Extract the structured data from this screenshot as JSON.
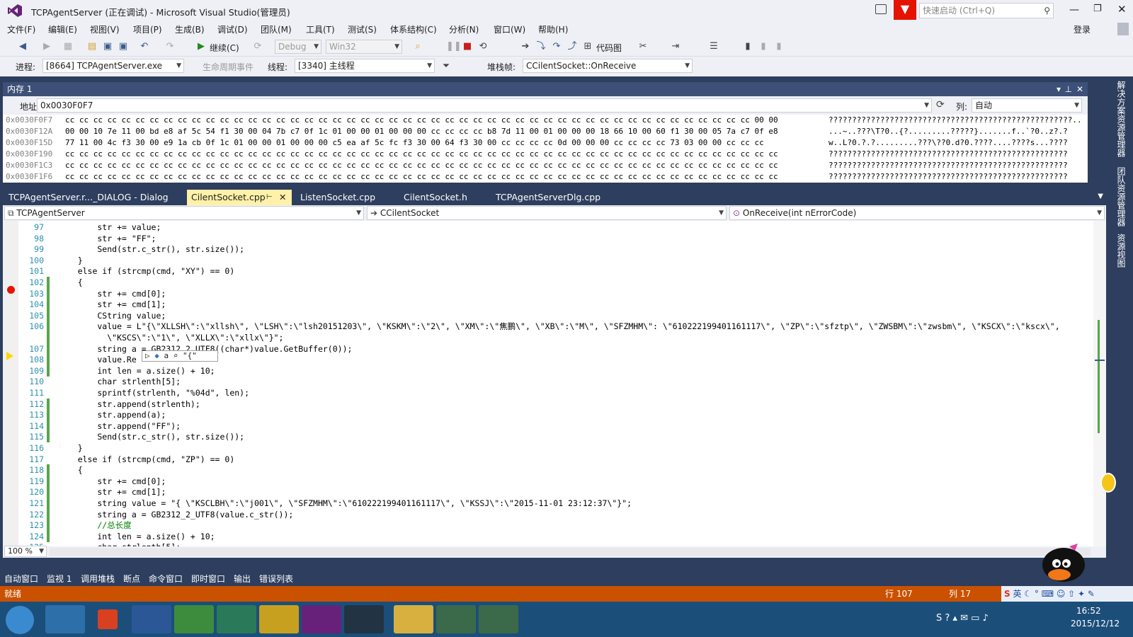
{
  "window": {
    "title": "TCPAgentServer (正在调试) - Microsoft Visual Studio(管理员)",
    "quick_launch": "快速启动 (Ctrl+Q)",
    "login": "登录"
  },
  "menu": [
    "文件(F)",
    "编辑(E)",
    "视图(V)",
    "项目(P)",
    "生成(B)",
    "调试(D)",
    "团队(M)",
    "工具(T)",
    "测试(S)",
    "体系结构(C)",
    "分析(N)",
    "窗口(W)",
    "帮助(H)"
  ],
  "toolbar1": {
    "continue": "继续(C)",
    "config": "Debug",
    "platform": "Win32",
    "codemap": "代码图"
  },
  "toolbar2": {
    "process_label": "进程:",
    "process": "[8664] TCPAgentServer.exe",
    "lifecycle": "生命周期事件",
    "thread_label": "线程:",
    "thread": "[3340] 主线程",
    "stack_label": "堆栈帧:",
    "stack": "CCilentSocket::OnReceive"
  },
  "memory": {
    "title": "内存 1",
    "addr_label": "地址:",
    "addr": "0x0030F0F7",
    "col_label": "列:",
    "col": "自动",
    "rows": [
      {
        "addr": "0x0030F0F7",
        "hex": "cc cc cc cc cc cc cc cc cc cc cc cc cc cc cc cc cc cc cc cc cc cc cc cc cc cc cc cc cc cc cc cc cc cc cc cc cc cc cc cc cc cc cc cc cc cc cc cc cc 00 00",
        "ascii": "????????????????????????????????????????????????????.."
      },
      {
        "addr": "0x0030F12A",
        "hex": "00 00 10 7e 11 00 bd e8 af 5c 54 f1 30 00 04 7b c7 0f 1c 01 00 00 01 00 00 00 cc cc cc cc b8 7d 11 00 01 00 00 00 18 66 10 00 60 f1 30 00 05 7a c7 0f e8",
        "ascii": "...~..???\\T?0..{?.........?????}.......f..`?0..z?.?"
      },
      {
        "addr": "0x0030F15D",
        "hex": "77 11 00 4c f3 30 00 e9 1a cb 0f 1c 01 00 00 01 00 00 00 c5 ea af 5c fc f3 30 00 64 f3 30 00 cc cc cc cc 0d 00 00 00 cc cc cc cc 73 03 00 00 cc cc cc",
        "ascii": "w..L?0.?.?.........???\\??0.d?0.????....????s...????"
      },
      {
        "addr": "0x0030F190",
        "hex": "cc cc cc cc cc cc cc cc cc cc cc cc cc cc cc cc cc cc cc cc cc cc cc cc cc cc cc cc cc cc cc cc cc cc cc cc cc cc cc cc cc cc cc cc cc cc cc cc cc cc cc",
        "ascii": "???????????????????????????????????????????????????"
      },
      {
        "addr": "0x0030F1C3",
        "hex": "cc cc cc cc cc cc cc cc cc cc cc cc cc cc cc cc cc cc cc cc cc cc cc cc cc cc cc cc cc cc cc cc cc cc cc cc cc cc cc cc cc cc cc cc cc cc cc cc cc cc cc",
        "ascii": "???????????????????????????????????????????????????"
      },
      {
        "addr": "0x0030F1F6",
        "hex": "cc cc cc cc cc cc cc cc cc cc cc cc cc cc cc cc cc cc cc cc cc cc cc cc cc cc cc cc cc cc cc cc cc cc cc cc cc cc cc cc cc cc cc cc cc cc cc cc cc cc cc",
        "ascii": "???????????????????????????????????????????????????"
      }
    ]
  },
  "tabs": [
    "TCPAgentServer.r..._DIALOG - Dialog",
    "CilentSocket.cpp",
    "ListenSocket.cpp",
    "CilentSocket.h",
    "TCPAgentServerDlg.cpp"
  ],
  "nav": {
    "project": "TCPAgentServer",
    "class": "CCilentSocket",
    "method": "OnReceive(int nErrorCode)"
  },
  "code": [
    {
      "n": "97",
      "t": "        str += value;"
    },
    {
      "n": "98",
      "t": "        str += \"FF\";"
    },
    {
      "n": "99",
      "t": "        Send(str.c_str(), str.size());"
    },
    {
      "n": "100",
      "t": "    }"
    },
    {
      "n": "101",
      "t": "    else if (strcmp(cmd, \"XY\") == 0)"
    },
    {
      "n": "102",
      "t": "    {"
    },
    {
      "n": "103",
      "t": "        str += cmd[0];"
    },
    {
      "n": "104",
      "t": "        str += cmd[1];"
    },
    {
      "n": "105",
      "t": "        CString value;"
    },
    {
      "n": "106",
      "t": "        value = L\"{\\\"XLLSH\\\":\\\"xllsh\\\", \\\"LSH\\\":\\\"lsh20151203\\\", \\\"KSKM\\\":\\\"2\\\", \\\"XM\\\":\\\"焦鹏\\\", \\\"XB\\\":\\\"M\\\", \\\"SFZMHM\\\": \\\"610222199401161117\\\", \\\"ZP\\\":\\\"sfztp\\\", \\\"ZWSBM\\\":\\\"zwsbm\\\", \\\"KSCX\\\":\\\"kscx\\\","
    },
    {
      "n": "",
      "t": "          \\\"KSCS\\\":\\\"1\\\", \\\"XLLX\\\":\\\"xllx\\\"}\";"
    },
    {
      "n": "107",
      "t": "        string a = GB2312_2_UTF8((char*)value.GetBuffer(0));"
    },
    {
      "n": "108",
      "t": "        value.Re"
    },
    {
      "n": "109",
      "t": "        int len = a.size() + 10;"
    },
    {
      "n": "110",
      "t": "        char strlenth[5];"
    },
    {
      "n": "111",
      "t": "        sprintf(strlenth, \"%04d\", len);"
    },
    {
      "n": "112",
      "t": "        str.append(strlenth);"
    },
    {
      "n": "113",
      "t": "        str.append(a);"
    },
    {
      "n": "114",
      "t": "        str.append(\"FF\");"
    },
    {
      "n": "115",
      "t": "        Send(str.c_str(), str.size());"
    },
    {
      "n": "116",
      "t": "    }"
    },
    {
      "n": "117",
      "t": "    else if (strcmp(cmd, \"ZP\") == 0)"
    },
    {
      "n": "118",
      "t": "    {"
    },
    {
      "n": "119",
      "t": "        str += cmd[0];"
    },
    {
      "n": "120",
      "t": "        str += cmd[1];"
    },
    {
      "n": "121",
      "t": "        string value = \"{ \\\"KSCLBH\\\":\\\"j001\\\", \\\"SFZMHM\\\":\\\"610222199401161117\\\", \\\"KSSJ\\\":\\\"2015-11-01 23:12:37\\\"}\";"
    },
    {
      "n": "122",
      "t": "        string a = GB2312_2_UTF8(value.c_str());"
    },
    {
      "n": "123",
      "t": "        //总长度"
    },
    {
      "n": "124",
      "t": "        int len = a.size() + 10;"
    },
    {
      "n": "125",
      "t": "        char strlenth[5];"
    }
  ],
  "datatip": {
    "var": "a",
    "value": "\"{\""
  },
  "zoom": "100 %",
  "bottom_tabs": [
    "自动窗口",
    "监视 1",
    "调用堆栈",
    "断点",
    "命令窗口",
    "即时窗口",
    "输出",
    "错误列表"
  ],
  "status": {
    "text": "就绪",
    "line": "行 107",
    "col": "列 17"
  },
  "side_tabs": [
    "解决方案资源管理器",
    "团队资源管理器",
    "资源视图"
  ],
  "taskbar": {
    "time": "16:52",
    "date": "2015/12/12",
    "ime": "英"
  }
}
